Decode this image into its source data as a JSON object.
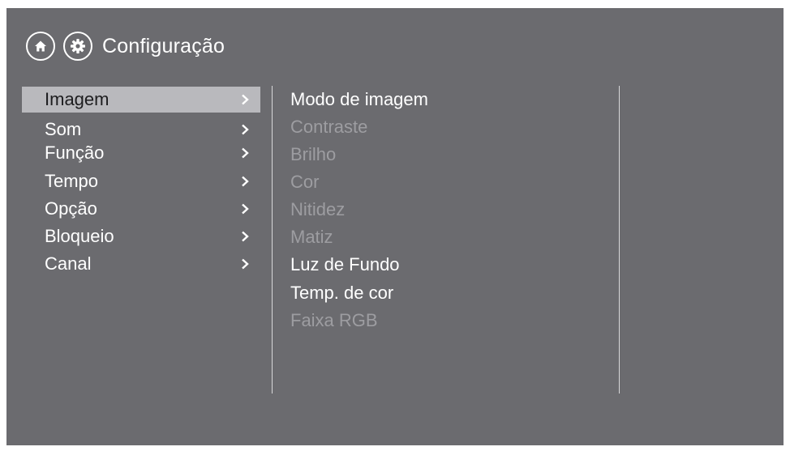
{
  "header": {
    "home_icon": "home-icon",
    "settings_icon": "gear-icon",
    "title": "Configuração"
  },
  "menu": {
    "items": [
      {
        "label": "Imagem",
        "selected": true
      },
      {
        "label": "Som",
        "selected": false
      },
      {
        "label": "Função",
        "selected": false
      },
      {
        "label": "Tempo",
        "selected": false
      },
      {
        "label": "Opção",
        "selected": false
      },
      {
        "label": "Bloqueio",
        "selected": false
      },
      {
        "label": "Canal",
        "selected": false
      }
    ]
  },
  "submenu": {
    "items": [
      {
        "label": "Modo de imagem",
        "enabled": true
      },
      {
        "label": "Contraste",
        "enabled": false
      },
      {
        "label": "Brilho",
        "enabled": false
      },
      {
        "label": "Cor",
        "enabled": false
      },
      {
        "label": "Nitidez",
        "enabled": false
      },
      {
        "label": "Matiz",
        "enabled": false
      },
      {
        "label": "Luz de Fundo",
        "enabled": true
      },
      {
        "label": "Temp. de cor",
        "enabled": true
      },
      {
        "label": "Faixa RGB",
        "enabled": false
      }
    ]
  },
  "colors": {
    "background": "#6b6b6f",
    "selection": "#b9b9bd",
    "text": "#ffffff",
    "disabled_text": "#9d9da1"
  }
}
